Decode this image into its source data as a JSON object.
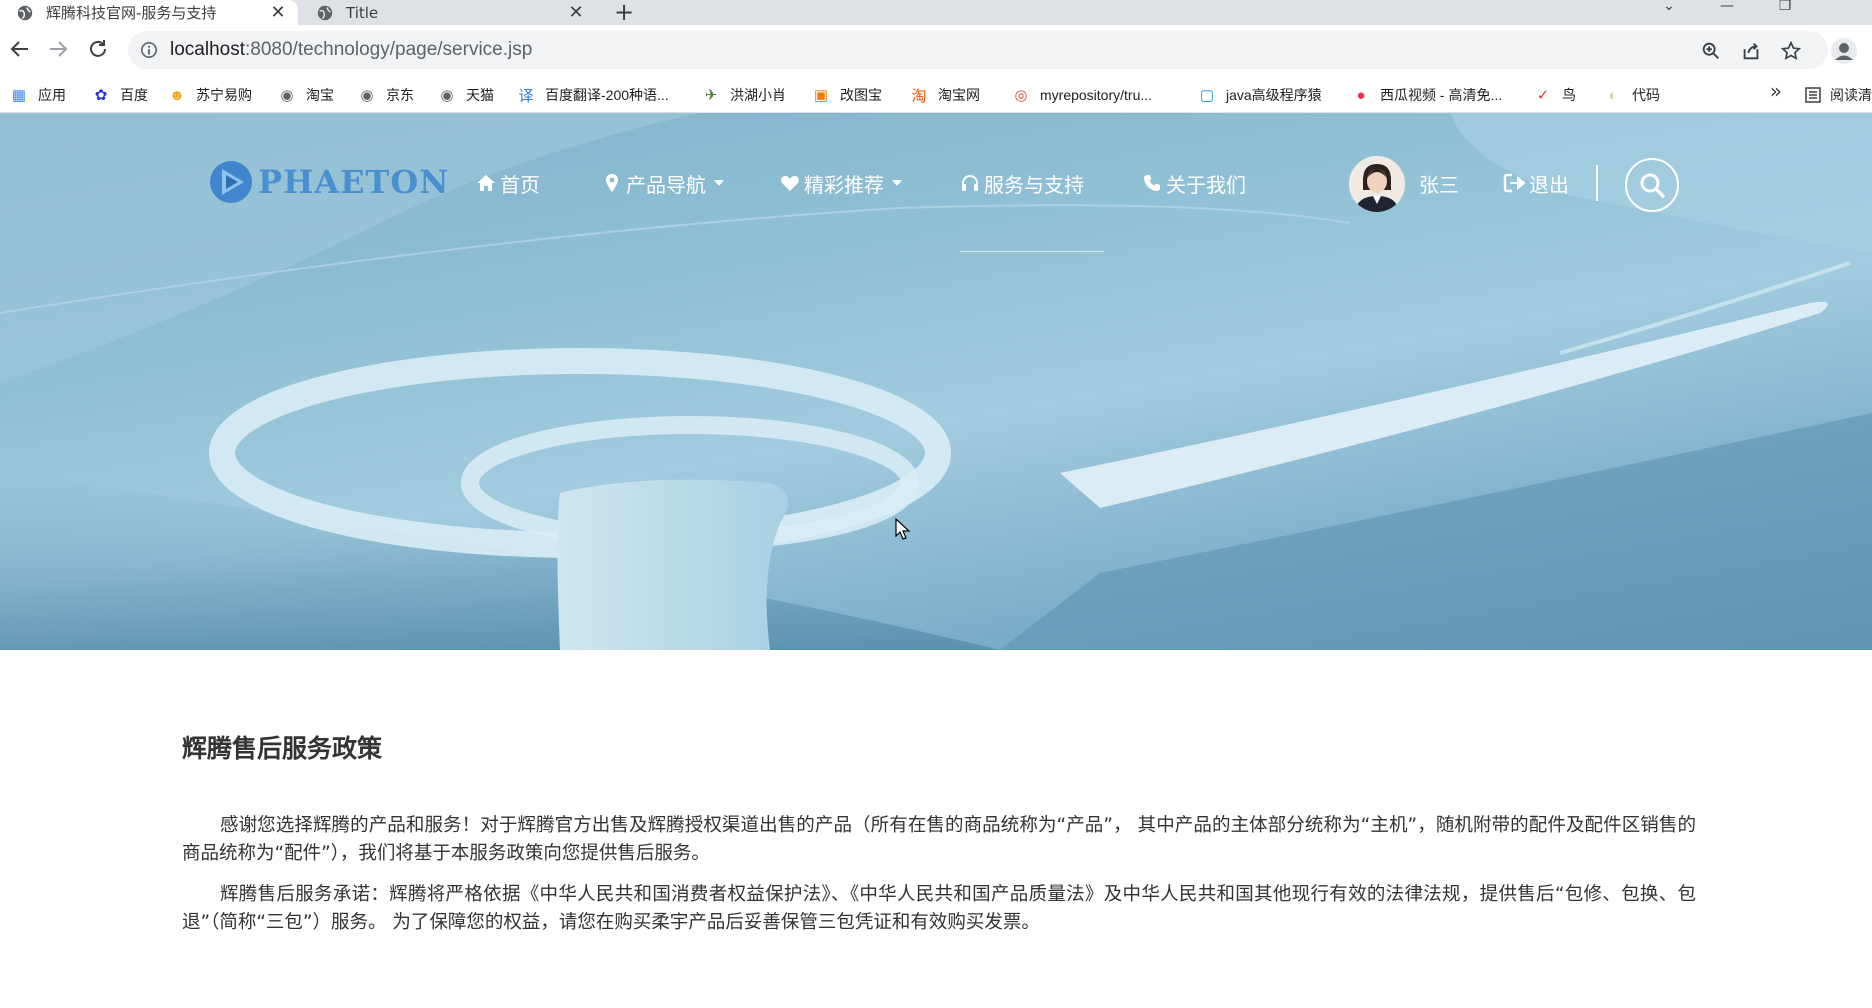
{
  "browser": {
    "tabs": [
      {
        "title": "辉腾科技官网-服务与支持",
        "active": true
      },
      {
        "title": "Title",
        "active": false
      }
    ],
    "url_host": "localhost",
    "url_path": ":8080/technology/page/service.jsp",
    "bookmarks": [
      {
        "label": "应用",
        "icon": "apps-grid-icon",
        "color": "#4285f4"
      },
      {
        "label": "百度",
        "icon": "baidu-paw-icon",
        "color": "#2932e1"
      },
      {
        "label": "苏宁易购",
        "icon": "suning-icon",
        "color": "#f5a623"
      },
      {
        "label": "淘宝",
        "icon": "globe-icon",
        "color": "#5f6368"
      },
      {
        "label": "京东",
        "icon": "globe-icon",
        "color": "#5f6368"
      },
      {
        "label": "天猫",
        "icon": "globe-icon",
        "color": "#5f6368"
      },
      {
        "label": "百度翻译-200种语...",
        "icon": "translate-icon",
        "color": "#2f7fe0"
      },
      {
        "label": "洪湖小肖",
        "icon": "bird-icon",
        "color": "#4a7a3a"
      },
      {
        "label": "改图宝",
        "icon": "gaitubao-icon",
        "color": "#f57c00"
      },
      {
        "label": "淘宝网",
        "icon": "taobao-icon",
        "color": "#ff5000"
      },
      {
        "label": "myrepository/tru...",
        "icon": "chrome-icon",
        "color": "#db4437"
      },
      {
        "label": "java高级程序猿",
        "icon": "bilibili-icon",
        "color": "#00a1d6"
      },
      {
        "label": "西瓜视频 - 高清免...",
        "icon": "xigua-icon",
        "color": "#fe2c55"
      },
      {
        "label": "鸟",
        "icon": "bird-red-icon",
        "color": "#e53935"
      },
      {
        "label": "代码",
        "icon": "code-icon",
        "color": "#c5e1a5"
      }
    ],
    "reading_list": "阅读清"
  },
  "site": {
    "logo_text": "PHAETON",
    "nav": [
      {
        "label": "首页",
        "icon": "home-icon",
        "dropdown": false
      },
      {
        "label": "产品导航",
        "icon": "map-marker-icon",
        "dropdown": true
      },
      {
        "label": "精彩推荐",
        "icon": "heart-icon",
        "dropdown": true
      },
      {
        "label": "服务与支持",
        "icon": "headphones-icon",
        "dropdown": false
      },
      {
        "label": "关于我们",
        "icon": "phone-icon",
        "dropdown": false
      }
    ],
    "user": {
      "name": "张三"
    },
    "logout_label": "退出"
  },
  "content": {
    "title": "辉腾售后服务政策",
    "paragraphs": [
      "感谢您选择辉腾的产品和服务！对于辉腾官方出售及辉腾授权渠道出售的产品（所有在售的商品统称为“产品”， 其中产品的主体部分统称为“主机”，随机附带的配件及配件区销售的商品统称为“配件”），我们将基于本服务政策向您提供售后服务。",
      "辉腾售后服务承诺：辉腾将严格依据《中华人民共和国消费者权益保护法》、《中华人民共和国产品质量法》及中华人民共和国其他现行有效的法律法规，提供售后“包修、包换、包退”（简称“三包”）服务。 为了保障您的权益，请您在购买柔宇产品后妥善保管三包凭证和有效购买发票。"
    ]
  }
}
